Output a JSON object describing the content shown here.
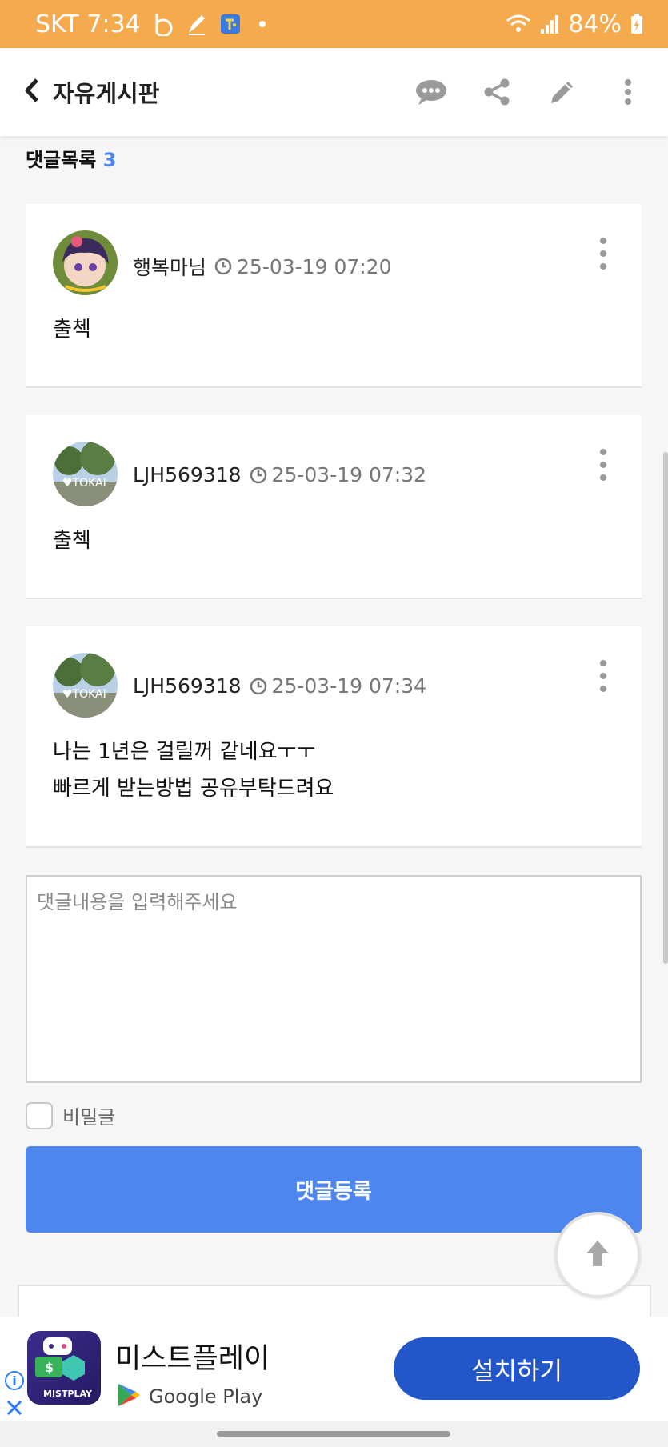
{
  "status_bar": {
    "carrier_time": "SKT 7:34",
    "battery": "84%",
    "bg_color": "#f4aa4d"
  },
  "header": {
    "title": "자유게시판",
    "icons": [
      "chevron-left-icon",
      "chat-bubble-icon",
      "share-icon",
      "pencil-icon",
      "more-vertical-icon"
    ]
  },
  "comments_section": {
    "title": "댓글목록",
    "count": "3",
    "accent_color": "#4d86ef"
  },
  "comments": [
    {
      "author": "행복마님",
      "timestamp": "25-03-19 07:20",
      "lines": [
        "출첵"
      ]
    },
    {
      "author": "LJH569318",
      "timestamp": "25-03-19 07:32",
      "lines": [
        "출첵"
      ]
    },
    {
      "author": "LJH569318",
      "timestamp": "25-03-19 07:34",
      "lines": [
        "나는 1년은 걸릴꺼 같네요ㅜㅜ",
        "빠르게 받는방법 공유부탁드려요"
      ]
    }
  ],
  "comment_form": {
    "placeholder": "댓글내용을 입력해주세요",
    "secret_label": "비밀글",
    "submit_label": "댓글등록"
  },
  "ad": {
    "app_name": "미스트플레이",
    "store": "Google Play",
    "install_label": "설치하기",
    "icon_label": "MISTPLAY",
    "button_color": "#2356c8"
  }
}
